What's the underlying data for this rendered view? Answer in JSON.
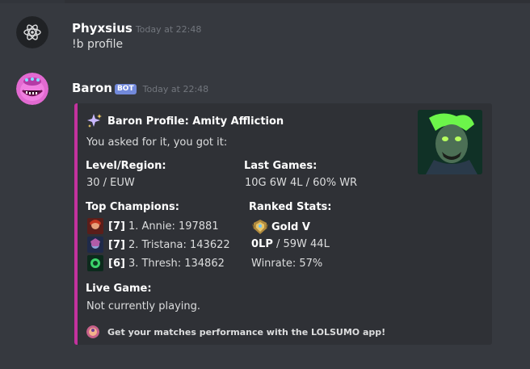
{
  "messages": [
    {
      "username": "Phyxsius",
      "timestamp": "Today at 22:48",
      "text": "!b profile",
      "avatar_icon": "atom-icon"
    },
    {
      "username": "Baron",
      "bot_tag": "BOT",
      "timestamp": "Today at 22:48",
      "avatar_icon": "baron-avatar"
    }
  ],
  "embed": {
    "accent_color": "#c3329e",
    "author": "Baron Profile: Amity Affliction",
    "description": "You asked for it, you got it:",
    "fields": {
      "level_region": {
        "name": "Level/Region:",
        "value": "30 / EUW"
      },
      "last_games": {
        "name": "Last Games:",
        "value": "10G 6W 4L / 60% WR"
      },
      "top_champions": {
        "name": "Top Champions:"
      },
      "ranked_stats": {
        "name": "Ranked Stats:"
      },
      "live_game": {
        "name": "Live Game:",
        "value": "Not currently playing."
      }
    },
    "champions": [
      {
        "level": "[7]",
        "text": "1. Annie: 197881",
        "icon": "annie-icon"
      },
      {
        "level": "[7]",
        "text": "2. Tristana: 143622",
        "icon": "tristana-icon"
      },
      {
        "level": "[6]",
        "text": "3. Thresh: 134862",
        "icon": "thresh-icon"
      }
    ],
    "ranked": {
      "tier": "Gold V",
      "lp": "0LP",
      "record": " / 59W 44L",
      "winrate": "Winrate: 57%"
    },
    "footer": "Get your matches performance with the LOLSUMO app!"
  }
}
